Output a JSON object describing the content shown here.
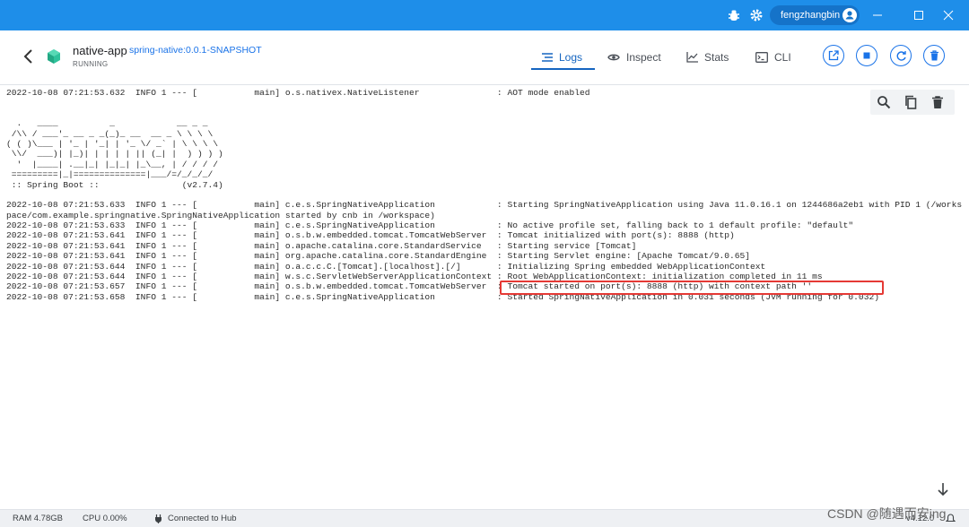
{
  "titlebar": {
    "username": "fengzhangbin",
    "bg_color": "#1e8ee9"
  },
  "header": {
    "app_name": "native-app",
    "image_name": "spring-native:0.0.1-SNAPSHOT",
    "status": "RUNNING",
    "tabs": [
      {
        "label": "Logs",
        "icon": "logs-icon",
        "active": true
      },
      {
        "label": "Inspect",
        "icon": "eye-icon",
        "active": false
      },
      {
        "label": "Stats",
        "icon": "stats-icon",
        "active": false
      },
      {
        "label": "CLI",
        "icon": "terminal-icon",
        "active": false
      }
    ],
    "actions": [
      "open-in-browser-icon",
      "stop-icon",
      "restart-icon",
      "delete-icon"
    ]
  },
  "logs": {
    "lines": [
      "2022-10-08 07:21:53.632  INFO 1 --- [           main] o.s.nativex.NativeListener               : AOT mode enabled",
      "",
      "",
      "  .   ____          _            __ _ _",
      " /\\\\ / ___'_ __ _ _(_)_ __  __ _ \\ \\ \\ \\",
      "( ( )\\___ | '_ | '_| | '_ \\/ _` | \\ \\ \\ \\",
      " \\\\/  ___)| |_)| | | | | || (_| |  ) ) ) )",
      "  '  |____| .__|_| |_|_| |_\\__, | / / / /",
      " =========|_|==============|___/=/_/_/_/",
      " :: Spring Boot ::                (v2.7.4)",
      "",
      "2022-10-08 07:21:53.633  INFO 1 --- [           main] c.e.s.SpringNativeApplication            : Starting SpringNativeApplication using Java 11.0.16.1 on 1244686a2eb1 with PID 1 (/works",
      "pace/com.example.springnative.SpringNativeApplication started by cnb in /workspace)",
      "2022-10-08 07:21:53.633  INFO 1 --- [           main] c.e.s.SpringNativeApplication            : No active profile set, falling back to 1 default profile: \"default\"",
      "2022-10-08 07:21:53.641  INFO 1 --- [           main] o.s.b.w.embedded.tomcat.TomcatWebServer  : Tomcat initialized with port(s): 8888 (http)",
      "2022-10-08 07:21:53.641  INFO 1 --- [           main] o.apache.catalina.core.StandardService   : Starting service [Tomcat]",
      "2022-10-08 07:21:53.641  INFO 1 --- [           main] org.apache.catalina.core.StandardEngine  : Starting Servlet engine: [Apache Tomcat/9.0.65]",
      "2022-10-08 07:21:53.644  INFO 1 --- [           main] o.a.c.c.C.[Tomcat].[localhost].[/]       : Initializing Spring embedded WebApplicationContext",
      "2022-10-08 07:21:53.644  INFO 1 --- [           main] w.s.c.ServletWebServerApplicationContext : Root WebApplicationContext: initialization completed in 11 ms",
      "2022-10-08 07:21:53.657  INFO 1 --- [           main] o.s.b.w.embedded.tomcat.TomcatWebServer  : Tomcat started on port(s): 8888 (http) with context path ''",
      "2022-10-08 07:21:53.658  INFO 1 --- [           main] c.e.s.SpringNativeApplication            : Started SpringNativeApplication in 0.031 seconds (JVM running for 0.032)"
    ]
  },
  "statusbar": {
    "ram": "RAM 4.78GB",
    "cpu": "CPU 0.00%",
    "connection": "Connected to Hub",
    "version": "v4.12.0"
  },
  "watermark": "CSDN @随遇而安ing",
  "colors": {
    "accent": "#1565c0",
    "highlight": "#e53935"
  }
}
